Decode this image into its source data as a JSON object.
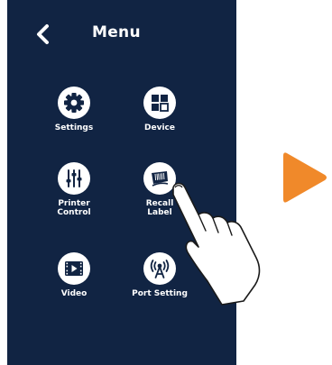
{
  "header": {
    "title": "Menu"
  },
  "menu": {
    "items": [
      {
        "id": "settings",
        "label": "Settings",
        "icon": "gear-icon"
      },
      {
        "id": "device",
        "label": "Device",
        "icon": "grid-icon"
      },
      {
        "id": "printer-control",
        "label": "Printer\nControl",
        "icon": "sliders-icon"
      },
      {
        "id": "recall-label",
        "label": "Recall\nLabel",
        "icon": "barcode-label-icon"
      },
      {
        "id": "video",
        "label": "Video",
        "icon": "video-play-icon"
      },
      {
        "id": "port-setting",
        "label": "Port Setting",
        "icon": "antenna-icon"
      }
    ]
  },
  "colors": {
    "screen_background": "#112443",
    "icon_background": "#ffffff",
    "text": "#ffffff",
    "accent_arrow": "#f0892a"
  }
}
